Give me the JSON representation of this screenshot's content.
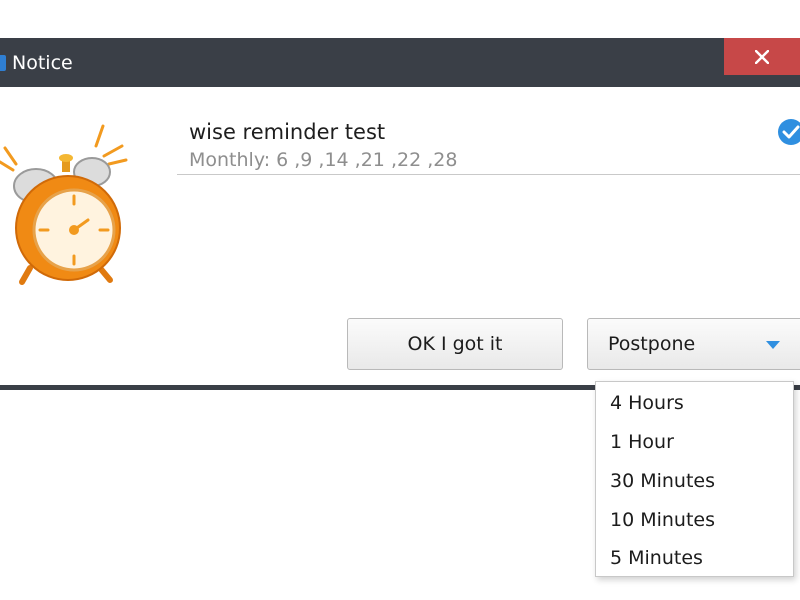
{
  "window": {
    "title": "Notice",
    "close_icon": "close-icon",
    "titlebar_color": "#3a3f47",
    "close_color": "#c74848"
  },
  "reminder": {
    "name": "wise reminder test",
    "schedule": "Monthly: 6 ,9 ,14 ,21 ,22 ,28",
    "icon": "alarm-clock-icon",
    "status_icon": "check-circle-icon",
    "accent": "#2f8fe0"
  },
  "buttons": {
    "ok_label": "OK I got it",
    "postpone_label": "Postpone",
    "postpone_icon": "chevron-down-icon"
  },
  "postpone_menu": {
    "options": [
      "4 Hours",
      "1 Hour",
      "30 Minutes",
      "10 Minutes",
      "5 Minutes"
    ]
  }
}
